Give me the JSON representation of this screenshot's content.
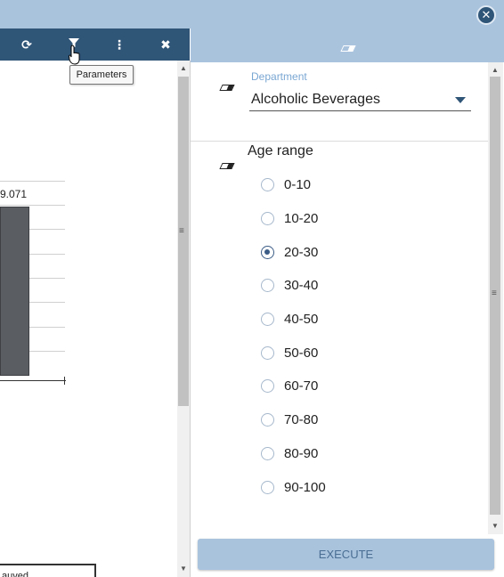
{
  "toolbar": {
    "icons": [
      "refresh-icon",
      "filter-icon",
      "more-vertical-icon",
      "close-icon"
    ],
    "tooltip": "Parameters"
  },
  "chart": {
    "value_label": "9.071",
    "bottom_text": "auved"
  },
  "parameters": {
    "department": {
      "label": "Department",
      "value": "Alcoholic Beverages"
    },
    "age_range": {
      "title": "Age range",
      "options": [
        "0-10",
        "10-20",
        "20-30",
        "30-40",
        "40-50",
        "50-60",
        "60-70",
        "70-80",
        "80-90",
        "90-100"
      ],
      "selected": "20-30"
    },
    "execute_label": "EXECUTE"
  },
  "colors": {
    "toolbar_bg": "#2f5577",
    "header_bg": "#a9c3dd",
    "accent": "#3b5c86",
    "label_blue": "#7aa7d3"
  }
}
